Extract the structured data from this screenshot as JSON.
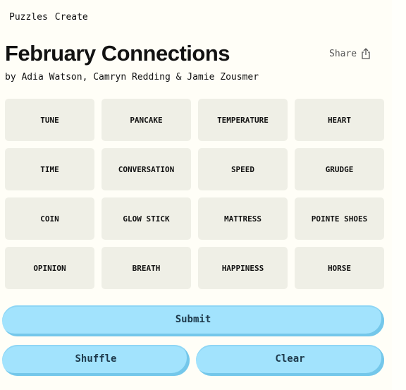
{
  "nav": {
    "items": [
      {
        "label": "Puzzles"
      },
      {
        "label": "Create"
      }
    ]
  },
  "header": {
    "title": "February Connections",
    "byline": "by Adia Watson, Camryn Redding & Jamie Zousmer",
    "share_label": "Share",
    "share_icon": "share-upload-icon"
  },
  "grid": {
    "rows": [
      [
        "TUNE",
        "PANCAKE",
        "TEMPERATURE",
        "HEART"
      ],
      [
        "TIME",
        "CONVERSATION",
        "SPEED",
        "GRUDGE"
      ],
      [
        "COIN",
        "GLOW STICK",
        "MATTRESS",
        "POINTE SHOES"
      ],
      [
        "OPINION",
        "BREATH",
        "HAPPINESS",
        "HORSE"
      ]
    ]
  },
  "actions": {
    "submit_label": "Submit",
    "shuffle_label": "Shuffle",
    "clear_label": "Clear"
  },
  "colors": {
    "background": "#fffef7",
    "tile": "#efefe6",
    "button": "#a2e3fd",
    "button_shadow": "#74c7ea",
    "button_text": "#1e3a4c"
  }
}
